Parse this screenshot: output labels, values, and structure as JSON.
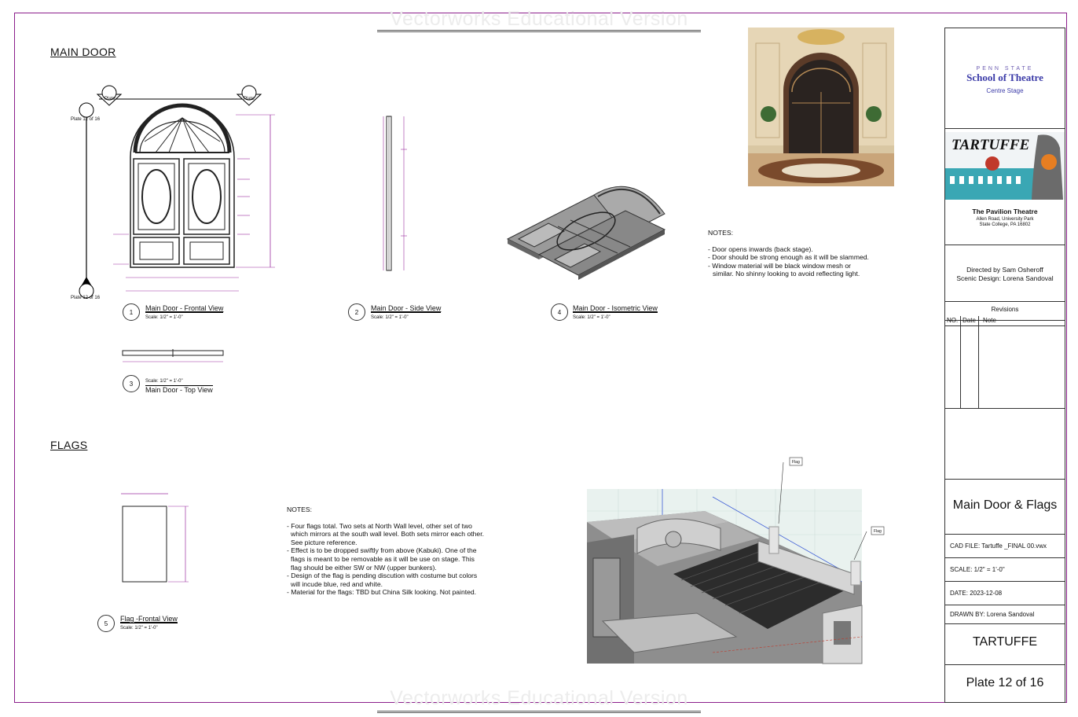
{
  "watermark": "Vectorworks Educational Version",
  "sections": {
    "main_door": "MAIN DOOR",
    "flags": "FLAGS"
  },
  "views": [
    {
      "num": "1",
      "title": "Main Door - Frontal View",
      "scale": "Scale: 1/2\" = 1'-0\""
    },
    {
      "num": "2",
      "title": "Main Door - Side View",
      "scale": "Scale: 1/2\" = 1'-0\""
    },
    {
      "num": "4",
      "title": "Main Door - Isometric  View",
      "scale": "Scale: 1/2\" = 1'-0\""
    },
    {
      "num": "3",
      "title": "Main Door - Top View",
      "scale": "Scale: 1/2\" = 1'-0\""
    },
    {
      "num": "5",
      "title": "Flag -Frontal View",
      "scale": "Scale: 1/2\" = 1'-0\""
    }
  ],
  "markers": {
    "plate_ref": "Plate 12 of 16",
    "plate_word": "Plate",
    "num2": "2",
    "num3": "3",
    "flag_tag": "Flag"
  },
  "door_notes": {
    "heading": "NOTES:",
    "lines": [
      "- Door opens inwards (back stage).",
      "- Door should be strong enough as it will be slammed.",
      "- Window material will be black window mesh or",
      "   similar. No shinny looking to avoid reflecting light."
    ]
  },
  "flag_notes": {
    "heading": "NOTES:",
    "lines": [
      "- Four flags total. Two sets at North Wall level, other set of two",
      "  which mirrors at the south wall level. Both sets mirror each other.",
      "  See picture reference.",
      "- Effect is to be dropped swiftly from above (Kabuki). One of the",
      "  flags is meant to be removable as it will be use on stage. This",
      "  flag should be either SW or NW (upper bunkers).",
      "- Design of the flag is pending discution with costume but colors",
      "  will incude blue, red and white.",
      "- Material for the flags: TBD but China Silk looking. Not painted."
    ]
  },
  "title_block": {
    "penn_state": "PENN STATE",
    "school": "School of Theatre",
    "centre": "Centre Stage",
    "poster_title": "TARTUFFE",
    "venue": "The Pavilion Theatre",
    "addr1": "Allen Road, University Park",
    "addr2": "State College, PA 16802",
    "directed": "Directed by Sam Osheroff",
    "scenic": "Scenic Design: Lorena Sandoval",
    "revisions": "Revisions",
    "rev_cols": [
      "NO.",
      "Date",
      "Note"
    ],
    "sheet_title": "Main Door & Flags",
    "cad_file": "CAD FILE: Tartuffe _FINAL 00.vwx",
    "scale": "SCALE:  1/2\" = 1'-0\"",
    "date": "DATE:  2023-12-08",
    "drawn_by": "DRAWN BY: Lorena Sandoval",
    "show": "TARTUFFE",
    "plate": "Plate 12 of 16"
  },
  "colors": {
    "border": "#8b1e8b",
    "school": "#3b3ba8",
    "dim": "#9b2fa0"
  }
}
